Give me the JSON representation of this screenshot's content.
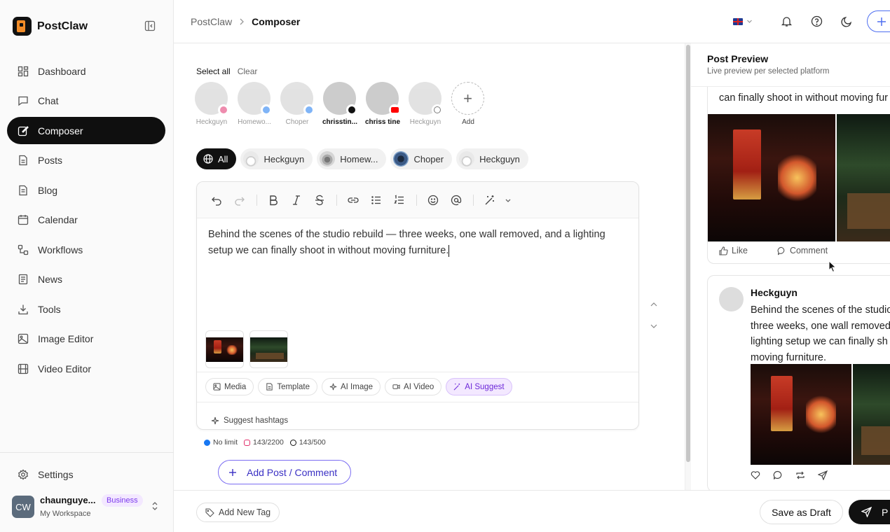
{
  "brand": {
    "name": "PostClaw"
  },
  "sidebar": {
    "items": [
      {
        "label": "Dashboard",
        "icon": "dashboard-icon"
      },
      {
        "label": "Chat",
        "icon": "chat-icon"
      },
      {
        "label": "Composer",
        "icon": "compose-icon",
        "active": true
      },
      {
        "label": "Posts",
        "icon": "posts-icon"
      },
      {
        "label": "Blog",
        "icon": "blog-icon"
      },
      {
        "label": "Calendar",
        "icon": "calendar-icon"
      },
      {
        "label": "Workflows",
        "icon": "workflows-icon"
      },
      {
        "label": "News",
        "icon": "news-icon"
      },
      {
        "label": "Tools",
        "icon": "tools-icon"
      },
      {
        "label": "Image Editor",
        "icon": "image-icon"
      },
      {
        "label": "Video Editor",
        "icon": "video-icon"
      }
    ],
    "settings": "Settings",
    "user": {
      "initials": "CW",
      "name": "chaunguye...",
      "workspace": "My Workspace",
      "plan": "Business"
    }
  },
  "header": {
    "breadcrumb_root": "PostClaw",
    "breadcrumb_current": "Composer"
  },
  "composer": {
    "select_all": "Select all",
    "clear": "Clear",
    "accounts": [
      {
        "label": "Heckguyn",
        "network": "instagram",
        "net_color": "#e1306c",
        "selected": false
      },
      {
        "label": "Homewo...",
        "network": "facebook",
        "net_color": "#1877f2",
        "selected": false
      },
      {
        "label": "Choper",
        "network": "facebook",
        "net_color": "#1877f2",
        "selected": false
      },
      {
        "label": "chrisstin...",
        "network": "tiktok",
        "net_color": "#111111",
        "selected": true
      },
      {
        "label": "chriss tine",
        "network": "youtube",
        "net_color": "#ff0000",
        "selected": true
      },
      {
        "label": "Heckguyn",
        "network": "threads",
        "net_color": "#111111",
        "selected": false
      }
    ],
    "add_label": "Add",
    "chips": {
      "all": "All",
      "items": [
        "Heckguyn",
        "Homew...",
        "Choper",
        "Heckguyn"
      ]
    },
    "text": "Behind the scenes of the studio rebuild — three weeks, one wall removed, and a lighting setup we can finally shoot in without moving furniture.",
    "actions": [
      "Media",
      "Template",
      "AI Image",
      "AI Video",
      "AI Suggest"
    ],
    "suggest_hashtags": "Suggest hashtags",
    "limits": {
      "facebook": "No limit",
      "instagram": "143/2200",
      "threads": "143/500"
    },
    "add_post": "Add Post / Comment"
  },
  "footer": {
    "add_tag": "Add New Tag",
    "save_draft": "Save as Draft",
    "publish": "P"
  },
  "preview": {
    "title": "Post Preview",
    "subtitle": "Live preview per selected platform",
    "card1": {
      "text": "can finally shoot in without moving fur",
      "like": "Like",
      "comment": "Comment"
    },
    "card2": {
      "name": "Heckguyn",
      "text": "Behind the scenes of the studio three weeks, one wall removed lighting setup we can finally sh moving furniture."
    }
  }
}
